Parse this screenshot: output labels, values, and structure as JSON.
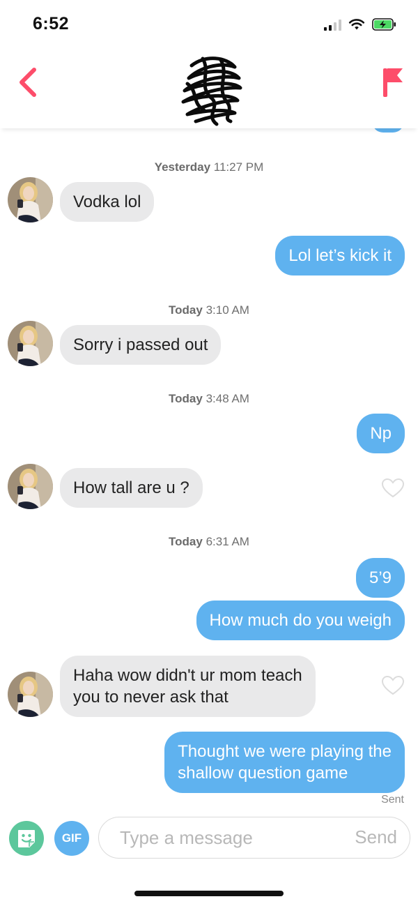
{
  "status_bar": {
    "time": "6:52"
  },
  "colors": {
    "accent": "#fd4d6a",
    "outgoing_bubble": "#5fb2ef",
    "incoming_bubble": "#e9e9ea",
    "sticker_button": "#5cc79c"
  },
  "header": {
    "back_icon": "chevron-left-icon",
    "flag_icon": "flag-icon"
  },
  "conversation": {
    "timestamps": [
      {
        "day": "Yesterday",
        "time": "11:27 PM"
      },
      {
        "day": "Today",
        "time": "3:10 AM"
      },
      {
        "day": "Today",
        "time": "3:48 AM"
      },
      {
        "day": "Today",
        "time": "6:31 AM"
      }
    ],
    "messages": [
      {
        "from": "them",
        "text": "Vodka lol"
      },
      {
        "from": "me",
        "text": "Lol let’s kick it"
      },
      {
        "from": "them",
        "text": "Sorry i passed out"
      },
      {
        "from": "me",
        "text": "Np"
      },
      {
        "from": "them",
        "text": "How tall are u ?"
      },
      {
        "from": "me",
        "text": "5’9"
      },
      {
        "from": "me",
        "text": "How much do you weigh"
      },
      {
        "from": "them",
        "text": "Haha wow didn't ur mom teach\nyou to never ask that"
      },
      {
        "from": "me",
        "text": "Thought we were playing the\nshallow question game"
      }
    ],
    "sent_label": "Sent"
  },
  "input_bar": {
    "sticker_icon": "smiley-sticker-icon",
    "gif_label": "GIF",
    "placeholder": "Type a message",
    "send_label": "Send"
  }
}
